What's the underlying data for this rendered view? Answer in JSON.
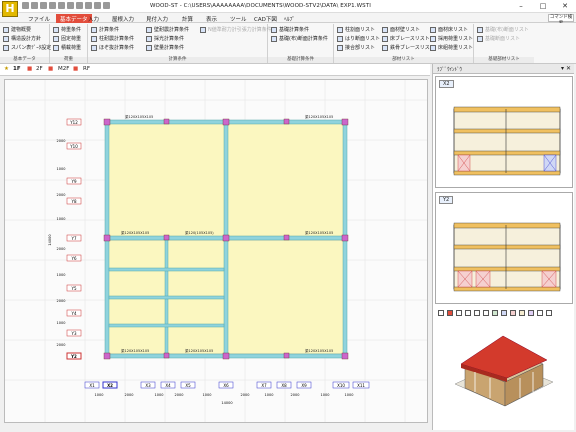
{
  "window": {
    "logo": "H",
    "title": "WOOD-ST - C:\\USERS\\AAAAAAAA\\DOCUMENTS\\WOOD-STV2\\DATA\\ EXP1.WSTI",
    "minimize": "–",
    "maximize": "□",
    "close": "✕"
  },
  "menu_tabs": [
    "ファイル",
    "基本データ",
    "入力",
    "屋根入力",
    "見付入力",
    "計算",
    "表示",
    "ツール",
    "CAD下図",
    "ﾍﾙﾌﾟ"
  ],
  "active_tab": "基本データ",
  "command_search": "コマンド検索",
  "ribbon": {
    "basic": {
      "items": [
        "建物概要",
        "構造設計方針",
        "スパン表ﾃﾞｰﾀ設定"
      ],
      "label": "基本データ"
    },
    "load": {
      "items": [
        "荷重条件",
        "固定荷重",
        "積載荷重"
      ],
      "label": "荷重"
    },
    "calc": {
      "col1": [
        "計算条件",
        "柱耐震計算条件",
        "ほぞ抜計算条件"
      ],
      "col2": [
        "壁耐震計算条件",
        "採光計算条件",
        "壁量計算条件"
      ],
      "col3": [
        "N値準耐力計引張力計算条件"
      ],
      "label": "計算条件"
    },
    "foundation": {
      "items": [
        "基礎計算条件",
        "基礎(布)断面計算条件"
      ],
      "label": "基礎計算条件"
    },
    "member": {
      "col1": [
        "柱割面リスト",
        "はり断面リスト",
        "接合部リスト"
      ],
      "col2": [
        "面材壁リスト",
        "床ブレースリスト",
        "鉄骨ブレースリスト"
      ],
      "col3": [
        "面材床リスト",
        "採用荷重リスト",
        "床組荷重リスト"
      ],
      "label": "部材リスト"
    },
    "found_list": {
      "items": [
        "基礎(布)断面リスト",
        "基礎断面リスト"
      ],
      "label": "基礎部材リスト"
    }
  },
  "floor_tabs": [
    "1F",
    "2F",
    "M2F",
    "RF"
  ],
  "active_floor": "1F",
  "plan": {
    "y_axes": [
      "Y12",
      "Y10",
      "Y9",
      "Y8",
      "Y7",
      "Y6",
      "Y5",
      "Y4",
      "Y3",
      "Y2"
    ],
    "x_axes": [
      "X1",
      "X2",
      "X3",
      "X4",
      "X5",
      "X6",
      "X7",
      "X8",
      "X9",
      "X10",
      "X11"
    ],
    "highlight_x": "X2",
    "highlight_y": "Y2",
    "y_dims": [
      "2000",
      "1000",
      "2000",
      "1000",
      "2000",
      "1000",
      "2000",
      "1000",
      "2000"
    ],
    "x_dims": [
      "1000",
      "2000",
      "1000",
      "2000",
      "1000",
      "2000",
      "1000",
      "2000",
      "1000",
      "1000"
    ],
    "total_x": "14000",
    "total_y": "14000",
    "beam_label": "梁120X105X105",
    "beam_label_alt": "梁120(105X105)",
    "colors": {
      "room_fill": "#fbf7c0",
      "wall": "#8fd3dd",
      "column": "#cc66cc"
    }
  },
  "side_panel": {
    "title": "ﾗﾌﾞﾞｳｲﾝﾄﾞｳ",
    "close": "▾ ✕",
    "frame1_label": "X2",
    "frame2_label": "Y2"
  },
  "statusbar": ""
}
